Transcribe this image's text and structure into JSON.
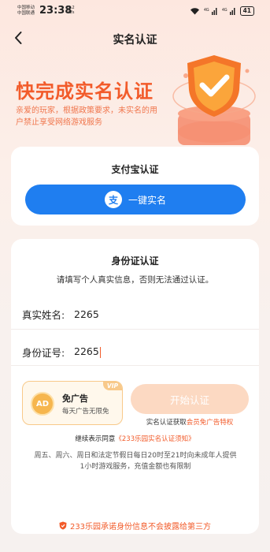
{
  "status_bar": {
    "carrier1": "中国移动",
    "carrier2": "中国联通",
    "time": "23:38",
    "net_speed_value": "2.2",
    "net_speed_unit": "K/s",
    "battery": "41"
  },
  "header": {
    "title": "实名认证",
    "back_icon": "chevron-left-icon"
  },
  "hero": {
    "title": "快完成实名认证",
    "description": "亲爱的玩家，根据政策要求，未实名的用户禁止享受网络游戏服务",
    "badge_icon": "shield-check-icon"
  },
  "alipay": {
    "title": "支付宝认证",
    "icon_char": "支",
    "button_label": "一键实名"
  },
  "id_card": {
    "title": "身份证认证",
    "subtitle": "请填写个人真实信息，否则无法通过认证。",
    "name_label": "真实姓名:",
    "name_value": "2265",
    "id_label": "身份证号:",
    "id_value": "2265"
  },
  "no_ad": {
    "vip_badge": "VIP",
    "ad_icon_text": "AD",
    "title": "免广告",
    "subtitle": "每天广告无限免"
  },
  "start_button": "开始认证",
  "vip_hint": {
    "text": "实名认证获取",
    "link": "会员免广告特权"
  },
  "agreement": {
    "text": "继续表示同意",
    "link": "《233乐园实名认证须知》"
  },
  "notice": "周五、周六、周日和法定节假日每日20时至21时向未成年人提供1小时游戏服务，充值金额也有限制",
  "promise": "233乐园承诺身份信息不会披露给第三方",
  "colors": {
    "accent": "#f25b2a",
    "alipay_blue": "#1f7ef0",
    "start_button_disabled": "#fcd9c2",
    "vip_gold": "#f8c98a"
  }
}
